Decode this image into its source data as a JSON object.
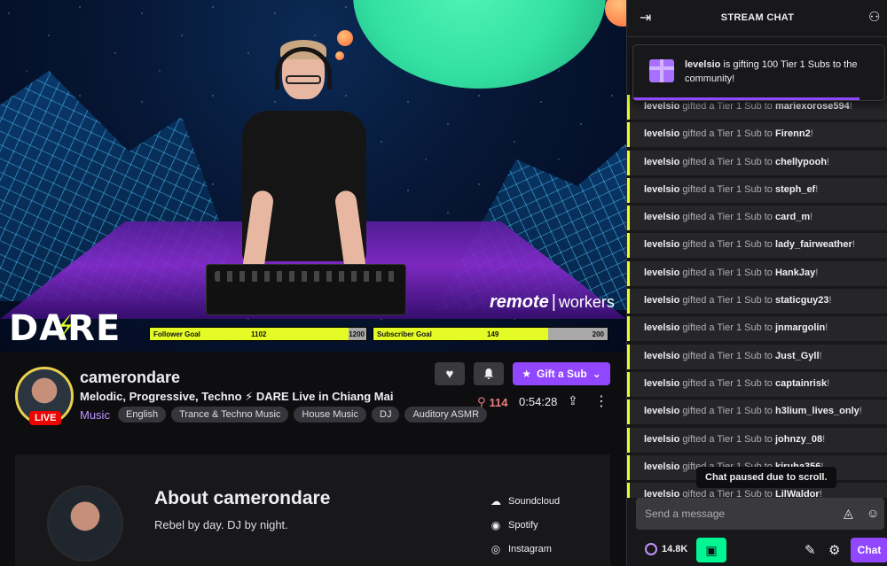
{
  "video": {
    "overlay_logo": "DARE",
    "sponsor_logo_left": "remote",
    "sponsor_logo_right": "workers",
    "follower_goal": {
      "label": "Follower Goal",
      "current": "1102",
      "target": "1200",
      "progress": 0.918
    },
    "subscriber_goal": {
      "label": "Subscriber Goal",
      "current": "149",
      "target": "200",
      "progress": 0.745
    }
  },
  "channel": {
    "name": "camerondare",
    "live_badge": "LIVE",
    "title": "Melodic, Progressive, Techno ⚡ DARE Live in Chiang Mai",
    "category": "Music",
    "tags": [
      "English",
      "Trance & Techno Music",
      "House Music",
      "DJ",
      "Auditory ASMR"
    ],
    "gift_button": "Gift a Sub",
    "viewers": "114",
    "uptime": "0:54:28"
  },
  "about": {
    "title": "About camerondare",
    "tagline": "Rebel by day. DJ by night.",
    "socials": [
      "Soundcloud",
      "Spotify",
      "Instagram"
    ]
  },
  "chat": {
    "header_title": "STREAM CHAT",
    "gift_banner": {
      "user": "levelsio",
      "text": " is gifting 100 Tier 1 Subs to the community!",
      "progress": 0.9
    },
    "message_prefix": " gifted a Tier 1 Sub to ",
    "messages": [
      {
        "user": "levelsio",
        "recipient": "mariexorose594"
      },
      {
        "user": "levelsio",
        "recipient": "Firenn2"
      },
      {
        "user": "levelsio",
        "recipient": "chellypooh"
      },
      {
        "user": "levelsio",
        "recipient": "steph_ef"
      },
      {
        "user": "levelsio",
        "recipient": "card_m"
      },
      {
        "user": "levelsio",
        "recipient": "lady_fairweather"
      },
      {
        "user": "levelsio",
        "recipient": "HankJay"
      },
      {
        "user": "levelsio",
        "recipient": "staticguy23"
      },
      {
        "user": "levelsio",
        "recipient": "jnmargolin"
      },
      {
        "user": "levelsio",
        "recipient": "Just_Gyll"
      },
      {
        "user": "levelsio",
        "recipient": "captainrisk"
      },
      {
        "user": "levelsio",
        "recipient": "h3lium_lives_only"
      },
      {
        "user": "levelsio",
        "recipient": "johnzy_08"
      },
      {
        "user": "levelsio",
        "recipient": "kiruha356"
      },
      {
        "user": "levelsio",
        "recipient": "LilWaldor"
      }
    ],
    "paused_notice": "Chat paused due to scroll.",
    "input_placeholder": "Send a message",
    "points": "14.8K",
    "send_button": "Chat"
  }
}
